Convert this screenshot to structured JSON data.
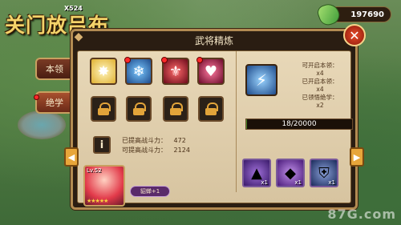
{
  "game_title": "关门放吕布",
  "player_level": "X524",
  "currency": {
    "icon": "leaf-gem-icon",
    "value": "197690"
  },
  "tabs": [
    {
      "label": "本领",
      "active": false
    },
    {
      "label": "绝学",
      "active": true
    }
  ],
  "panel": {
    "title": "武将精炼"
  },
  "skills": [
    {
      "name": "sun-burst-skill-icon",
      "color": "#f0d060",
      "has_alert": false
    },
    {
      "name": "ice-crystal-skill-icon",
      "color": "#2a6ab8",
      "has_alert": true
    },
    {
      "name": "crimson-wing-skill-icon",
      "color": "#a82030",
      "has_alert": true
    },
    {
      "name": "heart-skill-icon",
      "color": "#c02850",
      "has_alert": true
    }
  ],
  "locked_slots": 4,
  "stats": {
    "max_power_label": "已提高战斗力：",
    "max_power_value": "472",
    "power_label": "可提高战斗力：",
    "power_value": "2124"
  },
  "right_panel": {
    "line1": "可开启本领：",
    "line1_val": "x4",
    "line2": "已开启本领：",
    "line2_val": "x4",
    "line3": "已领悟绝学：",
    "line3_val": "x2",
    "progress_text": "18/20000",
    "progress_current": 18,
    "progress_max": 20000
  },
  "materials": [
    {
      "name": "purple-book-icon",
      "count": "x1",
      "color": "#5a2a8a"
    },
    {
      "name": "purple-gem-icon",
      "count": "x1",
      "color": "#6a2a9a"
    },
    {
      "name": "armor-icon",
      "count": "x1",
      "color": "#3a4a7a"
    }
  ],
  "hero": {
    "level": "Lv.52",
    "stars": "★★★★★",
    "name": "貂蝉+1"
  },
  "watermark": "87G.com"
}
